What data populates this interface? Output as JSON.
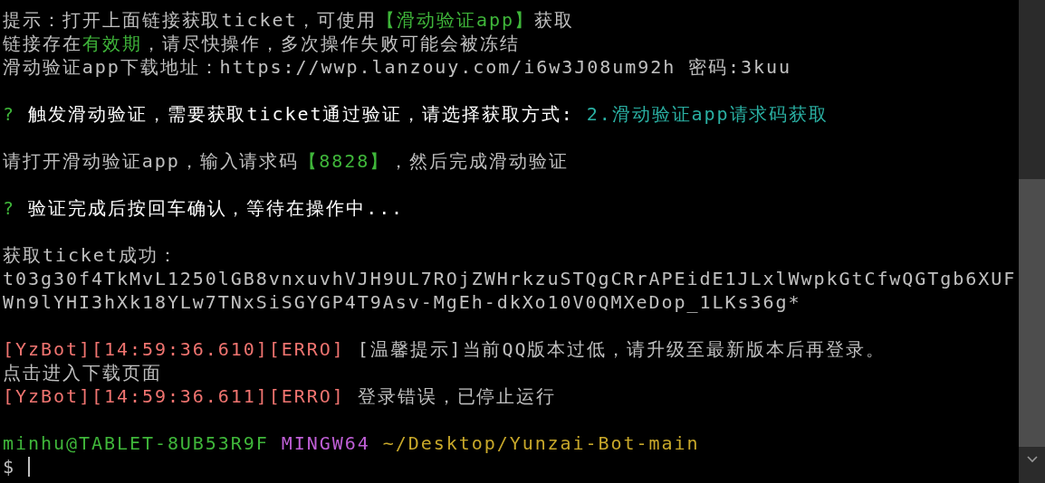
{
  "terminal": {
    "lines": [
      {
        "kind": "text",
        "segments": [
          {
            "text": "提示：打开上面链接获取ticket，可使用",
            "color": "#c0c0c0"
          },
          {
            "text": "【滑动验证app】",
            "color": "#3fb63a"
          },
          {
            "text": "获取",
            "color": "#c0c0c0"
          }
        ]
      },
      {
        "kind": "text",
        "segments": [
          {
            "text": "链接存在",
            "color": "#c0c0c0"
          },
          {
            "text": "有效期",
            "color": "#3fb63a"
          },
          {
            "text": "，请尽快操作，多次操作失败可能会被冻结",
            "color": "#c0c0c0"
          }
        ]
      },
      {
        "kind": "text",
        "segments": [
          {
            "text": "滑动验证app下载地址：https://wwp.lanzouy.com/i6w3J08um92h 密码:3kuu",
            "color": "#c0c0c0"
          }
        ]
      },
      {
        "kind": "blank"
      },
      {
        "kind": "text",
        "segments": [
          {
            "text": "?",
            "color": "#3fb63a"
          },
          {
            "text": " 触发滑动验证，需要获取ticket通过验证，请选择获取方式: ",
            "color": "#ffffff"
          },
          {
            "text": "2.滑动验证app请求码获取",
            "color": "#2ab0a3"
          }
        ]
      },
      {
        "kind": "blank"
      },
      {
        "kind": "text",
        "segments": [
          {
            "text": "请打开滑动验证app，输入请求码",
            "color": "#c0c0c0"
          },
          {
            "text": "【8828】",
            "color": "#3fb63a"
          },
          {
            "text": "，然后完成滑动验证",
            "color": "#c0c0c0"
          }
        ]
      },
      {
        "kind": "blank"
      },
      {
        "kind": "text",
        "segments": [
          {
            "text": "?",
            "color": "#3fb63a"
          },
          {
            "text": " 验证完成后按回车确认，等待在操作中...",
            "color": "#ffffff"
          }
        ]
      },
      {
        "kind": "blank"
      },
      {
        "kind": "text",
        "segments": [
          {
            "text": "获取ticket成功：",
            "color": "#c0c0c0"
          }
        ]
      },
      {
        "kind": "text",
        "segments": [
          {
            "text": "t03g30f4TkMvL1250lGB8vnxuvhVJH9UL7ROjZWHrkzuSTQgCRrAPEidE1JLxlWwpkGtCfwQGTgb6XUF",
            "color": "#c0c0c0"
          }
        ]
      },
      {
        "kind": "text",
        "segments": [
          {
            "text": "Wn9lYHI3hXk18YLw7TNxSiSGYGP4T9Asv-MgEh-dkXo10V0QMXeDop_1LKs36g*",
            "color": "#c0c0c0"
          }
        ]
      },
      {
        "kind": "blank"
      },
      {
        "kind": "text",
        "segments": [
          {
            "text": "[YzBot][14:59:36.610][ERRO]",
            "color": "#f07470"
          },
          {
            "text": " [温馨提示]当前QQ版本过低，请升级至最新版本后再登录。",
            "color": "#c0c0c0"
          }
        ]
      },
      {
        "kind": "text",
        "segments": [
          {
            "text": "点击进入下载页面",
            "color": "#c0c0c0"
          }
        ]
      },
      {
        "kind": "text",
        "segments": [
          {
            "text": "[YzBot][14:59:36.611][ERRO]",
            "color": "#f07470"
          },
          {
            "text": " 登录错误，已停止运行",
            "color": "#c0c0c0"
          }
        ]
      },
      {
        "kind": "blank"
      },
      {
        "kind": "text",
        "segments": [
          {
            "text": "minhu@TABLET-8UB53R9F",
            "color": "#3fb63a"
          },
          {
            "text": " MINGW64",
            "color": "#bf5fd6"
          },
          {
            "text": " ~/Desktop/Yunzai-Bot-main",
            "color": "#c8a82a"
          }
        ]
      },
      {
        "kind": "prompt",
        "segments": [
          {
            "text": "$",
            "color": "#c0c0c0"
          }
        ]
      }
    ]
  }
}
